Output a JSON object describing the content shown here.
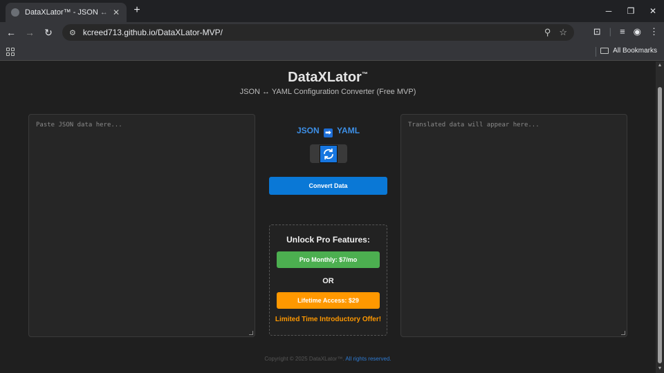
{
  "browser": {
    "tab_title": "DataXLator™ - JSON ↔ YAML Tr",
    "tab_close": "✕",
    "new_tab": "+",
    "url": "kcreed713.github.io/DataXLator-MVP/",
    "bookmarks_label": "All Bookmarks"
  },
  "app": {
    "title": "DataXLator",
    "title_tm": "™",
    "subtitle": "JSON ↔ YAML Configuration Converter (Free MVP)",
    "input_placeholder": "Paste JSON data here...",
    "output_placeholder": "Translated data will appear here...",
    "direction": {
      "from": "JSON",
      "arrow": "➡",
      "to": "YAML"
    },
    "convert_label": "Convert Data",
    "pro": {
      "title": "Unlock Pro Features:",
      "monthly_label": "Pro Monthly: $7/mo",
      "or_label": "OR",
      "lifetime_label": "Lifetime Access: $29",
      "offer": "Limited Time Introductory Offer!"
    },
    "footer": {
      "copyright": "Copyright © 2025 DataXLator™.",
      "rights": " All rights reserved."
    }
  },
  "colors": {
    "accent_blue": "#0a78d6",
    "green": "#4caf50",
    "orange": "#ff9800"
  }
}
